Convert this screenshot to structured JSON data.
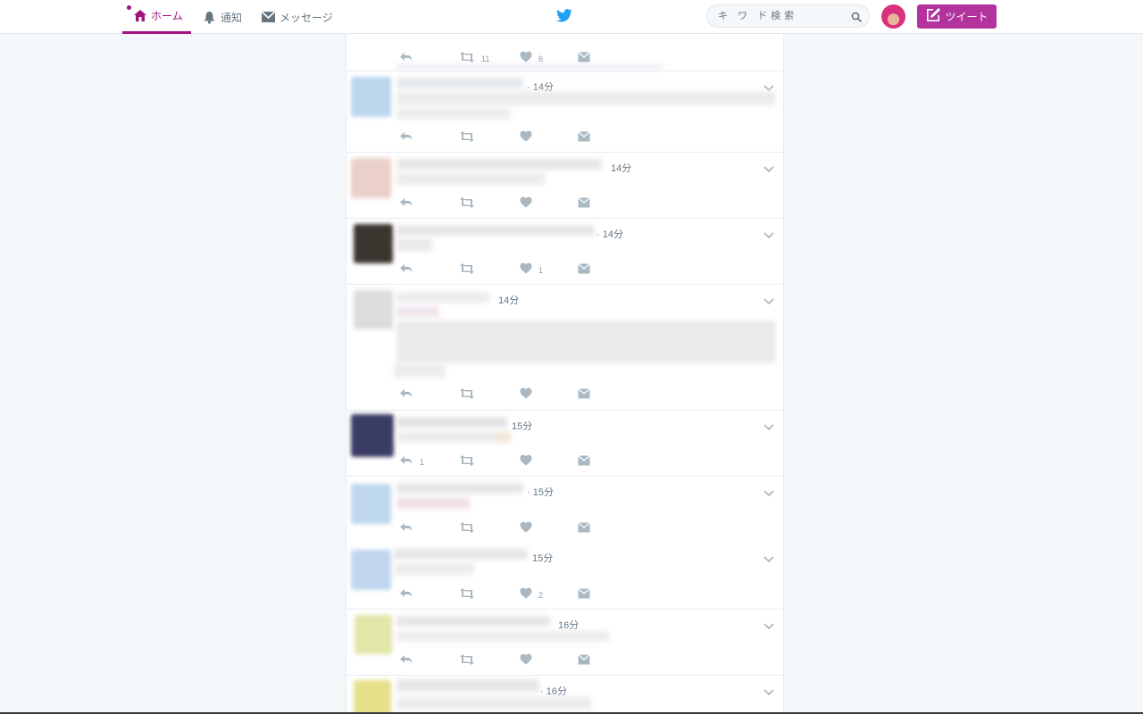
{
  "nav": {
    "home_label": "ホーム",
    "notifications_label": "通知",
    "messages_label": "メッセージ",
    "search_placeholder": "キ ワ ド検索",
    "tweet_button_label": "ツイート",
    "active_color": "#a3117e",
    "tweet_button_color": "#b3339e"
  },
  "tweets": [
    {
      "time": "",
      "reply_count": "",
      "retweet_count": "11",
      "like_count": "6"
    },
    {
      "time": "· 14分",
      "reply_count": "",
      "retweet_count": "",
      "like_count": ""
    },
    {
      "time": "14分",
      "reply_count": "",
      "retweet_count": "",
      "like_count": ""
    },
    {
      "time": "· 14分",
      "reply_count": "",
      "retweet_count": "",
      "like_count": "1"
    },
    {
      "time": "14分",
      "reply_count": "",
      "retweet_count": "",
      "like_count": ""
    },
    {
      "time": "15分",
      "reply_count": "1",
      "retweet_count": "",
      "like_count": ""
    },
    {
      "time": "· 15分",
      "reply_count": "",
      "retweet_count": "",
      "like_count": ""
    },
    {
      "time": "15分",
      "reply_count": "",
      "retweet_count": "",
      "like_count": "2"
    },
    {
      "time": "16分",
      "reply_count": "",
      "retweet_count": "",
      "like_count": ""
    },
    {
      "time": "· 16分",
      "reply_count": "",
      "retweet_count": "",
      "like_count": ""
    }
  ],
  "icons": {
    "home": "home-icon",
    "notifications": "bell-icon",
    "messages": "envelope-icon",
    "logo": "twitter-bird-icon",
    "search": "search-icon",
    "compose": "compose-icon",
    "reply": "reply-icon",
    "retweet": "retweet-icon",
    "like": "heart-icon",
    "dm": "direct-message-icon",
    "caret": "chevron-down-icon"
  },
  "colors": {
    "icon_gray": "#aab8c2",
    "background": "#f5f8fa"
  }
}
